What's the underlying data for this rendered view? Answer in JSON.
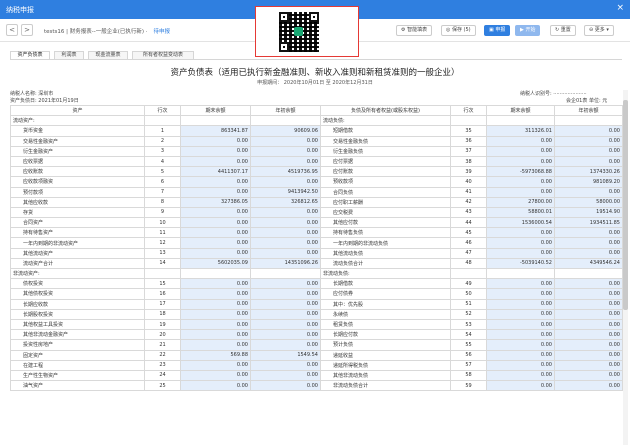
{
  "window": {
    "title": "纳税申报",
    "close_glyph": "×"
  },
  "toolbar": {
    "back_glyph": "<",
    "forward_glyph": ">",
    "breadcrumb": "tests16 | 财务报表--一般企业(已执行新) ·",
    "status": "待申报",
    "buttons": [
      "智能填表",
      "保存 (5)",
      "申报",
      "开始",
      "重置",
      "更多"
    ]
  },
  "tabs": [
    "资产负债表",
    "利润表",
    "现金流量表",
    "所有者权益变动表"
  ],
  "report": {
    "title": "资产负债表（适用已执行新金融准则、新收入准则和新租赁准则的一般企业）",
    "period": "申报期间： 2020年10月01日 至 2020年12月31日",
    "taxpayer_name": "纳税人名称: 深圳市",
    "fill_date": "资产负债日: 2021年01月19日",
    "taxpayer_id": "纳税人识别号: ·····················",
    "unit": "会企01表  单位: 元"
  },
  "table": {
    "headers": [
      "资产",
      "行次",
      "期末余额",
      "年初余额",
      "负债及所有者权益(或股东权益)",
      "行次",
      "期末余额",
      "年初余额"
    ],
    "rows": [
      [
        "流动资产:",
        "",
        "",
        "",
        "流动负债:",
        "",
        "",
        ""
      ],
      [
        "货币资金",
        "1",
        "863341.87",
        "90609.06",
        "短期借款",
        "35",
        "311326.01",
        "0.00"
      ],
      [
        "交易性金融资产",
        "2",
        "0.00",
        "0.00",
        "交易性金融负债",
        "36",
        "0.00",
        "0.00"
      ],
      [
        "衍生金融资产",
        "3",
        "0.00",
        "0.00",
        "衍生金融负债",
        "37",
        "0.00",
        "0.00"
      ],
      [
        "应收票据",
        "4",
        "0.00",
        "0.00",
        "应付票据",
        "38",
        "0.00",
        "0.00"
      ],
      [
        "应收账款",
        "5",
        "4411307.17",
        "4519736.95",
        "应付账款",
        "39",
        "-5973068.88",
        "1374330.26"
      ],
      [
        "应收款项融资",
        "6",
        "0.00",
        "0.00",
        "预收款项",
        "40",
        "0.00",
        "981089.20"
      ],
      [
        "预付款项",
        "7",
        "0.00",
        "9413942.50",
        "合同负债",
        "41",
        "0.00",
        "0.00"
      ],
      [
        "其他应收款",
        "8",
        "327386.05",
        "326812.65",
        "应付职工薪酬",
        "42",
        "27800.00",
        "58000.00"
      ],
      [
        "存货",
        "9",
        "0.00",
        "0.00",
        "应交税费",
        "43",
        "58800.01",
        "19514.90"
      ],
      [
        "合同资产",
        "10",
        "0.00",
        "0.00",
        "其他应付款",
        "44",
        "1536000.54",
        "1934511.85"
      ],
      [
        "持有待售资产",
        "11",
        "0.00",
        "0.00",
        "持有待售负债",
        "45",
        "0.00",
        "0.00"
      ],
      [
        "一年内到期的非流动资产",
        "12",
        "0.00",
        "0.00",
        "一年内到期的非流动负债",
        "46",
        "0.00",
        "0.00"
      ],
      [
        "其他流动资产",
        "13",
        "0.00",
        "0.00",
        "其他流动负债",
        "47",
        "0.00",
        "0.00"
      ],
      [
        "流动资产合计",
        "14",
        "5602035.09",
        "14351096.26",
        "流动负债合计",
        "48",
        "-5039140.52",
        "4349546.24"
      ],
      [
        "非流动资产:",
        "",
        "",
        "",
        "非流动负债:",
        "",
        "",
        ""
      ],
      [
        "债权投资",
        "15",
        "0.00",
        "0.00",
        "长期借款",
        "49",
        "0.00",
        "0.00"
      ],
      [
        "其他债权投资",
        "16",
        "0.00",
        "0.00",
        "应付债券",
        "50",
        "0.00",
        "0.00"
      ],
      [
        "长期应收款",
        "17",
        "0.00",
        "0.00",
        "其中：优先股",
        "51",
        "0.00",
        "0.00"
      ],
      [
        "长期股权投资",
        "18",
        "0.00",
        "0.00",
        "永续债",
        "52",
        "0.00",
        "0.00"
      ],
      [
        "其他权益工具投资",
        "19",
        "0.00",
        "0.00",
        "租赁负债",
        "53",
        "0.00",
        "0.00"
      ],
      [
        "其他非流动金融资产",
        "20",
        "0.00",
        "0.00",
        "长期应付款",
        "54",
        "0.00",
        "0.00"
      ],
      [
        "投资性房地产",
        "21",
        "0.00",
        "0.00",
        "预计负债",
        "55",
        "0.00",
        "0.00"
      ],
      [
        "固定资产",
        "22",
        "569.88",
        "1549.54",
        "递延收益",
        "56",
        "0.00",
        "0.00"
      ],
      [
        "在建工程",
        "23",
        "0.00",
        "0.00",
        "递延所得税负债",
        "57",
        "0.00",
        "0.00"
      ],
      [
        "生产性生物资产",
        "24",
        "0.00",
        "0.00",
        "其他非流动负债",
        "58",
        "0.00",
        "0.00"
      ],
      [
        "油气资产",
        "25",
        "0.00",
        "0.00",
        "非流动负债合计",
        "59",
        "0.00",
        "0.00"
      ]
    ]
  }
}
